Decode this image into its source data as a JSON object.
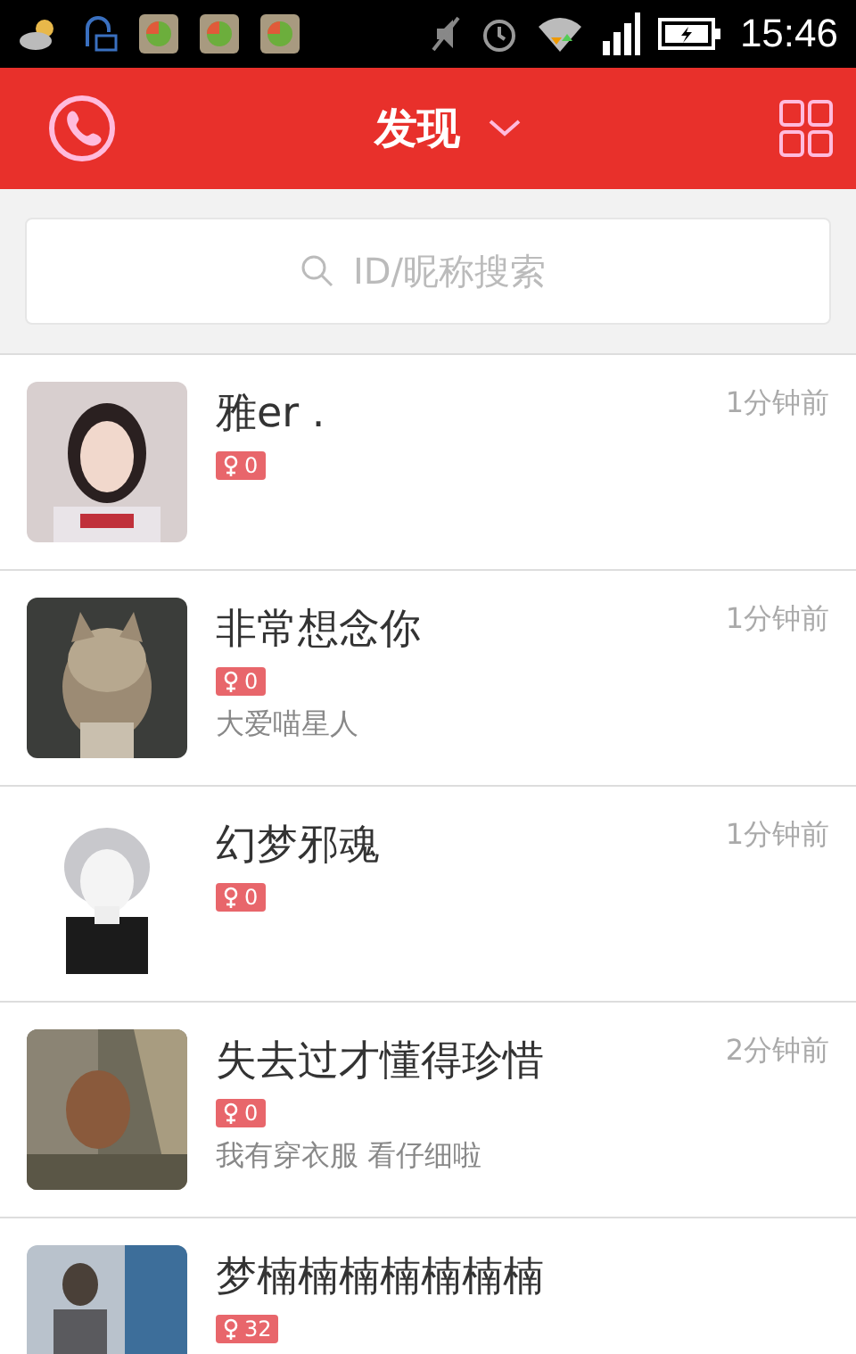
{
  "status_bar": {
    "time": "15:46"
  },
  "header": {
    "title": "发现"
  },
  "search": {
    "placeholder": "ID/昵称搜索"
  },
  "users": [
    {
      "name": "雅er .",
      "badge": "0",
      "time": "1分钟前"
    },
    {
      "name": "非常想念你",
      "badge": "0",
      "time": "1分钟前",
      "bio": "大爱喵星人"
    },
    {
      "name": "幻梦邪魂",
      "badge": "0",
      "time": "1分钟前"
    },
    {
      "name": "失去过才懂得珍惜",
      "badge": "0",
      "time": "2分钟前",
      "bio": "我有穿衣服 看仔细啦"
    },
    {
      "name": "梦楠楠楠楠楠楠楠",
      "badge": "32"
    }
  ]
}
